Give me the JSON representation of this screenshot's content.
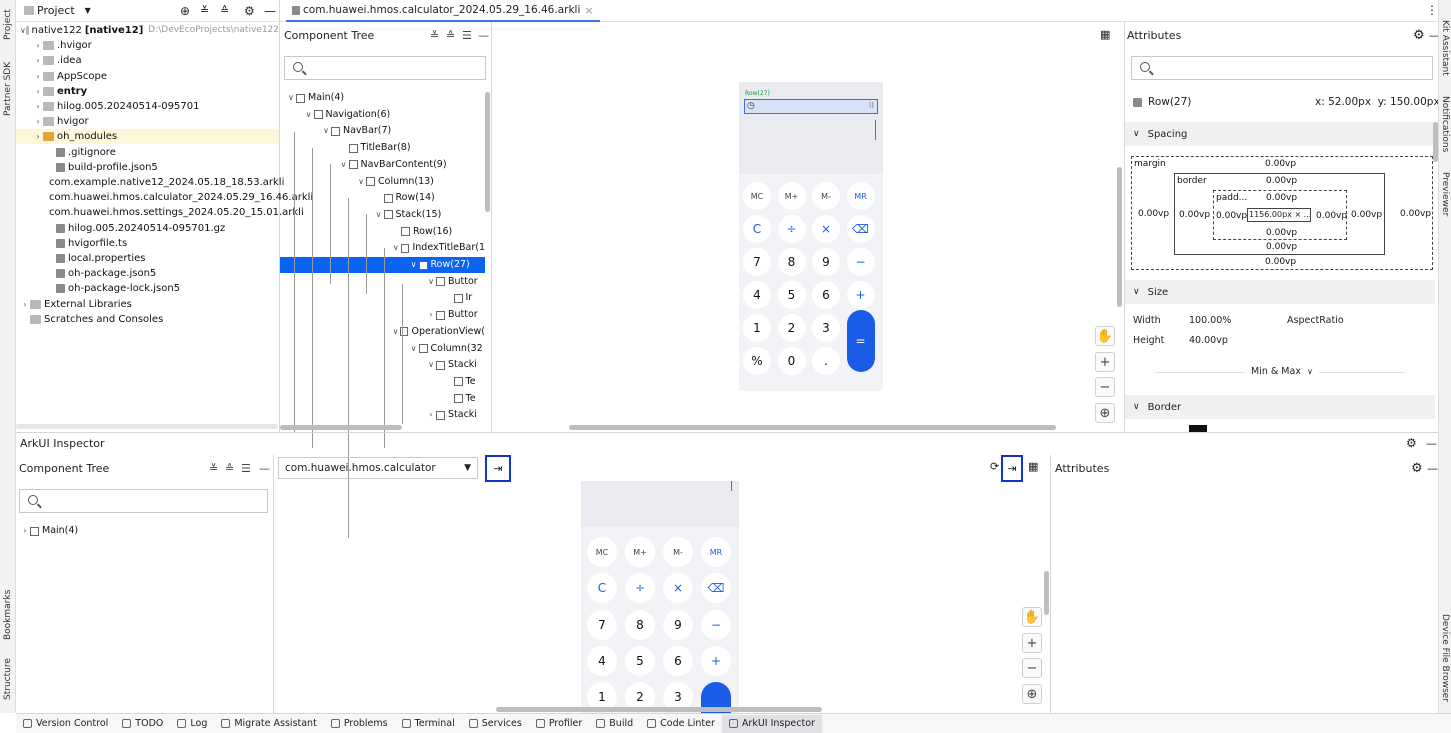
{
  "left_strip": {
    "items": [
      "Project",
      "Partner SDK",
      "Bookmarks",
      "Structure"
    ]
  },
  "right_strip": {
    "items": [
      "Kit Assistant",
      "Notifications",
      "Previewer",
      "Device File Browser"
    ]
  },
  "project_panel": {
    "title": "Project",
    "tree": [
      {
        "label": "native122",
        "bold_label": "[native12]",
        "path": "D:\\DevEcoProjects\\native122",
        "depth": 0,
        "chevron": "v",
        "kind": "folder"
      },
      {
        "label": ".hvigor",
        "depth": 1,
        "chevron": ">",
        "kind": "folder"
      },
      {
        "label": ".idea",
        "depth": 1,
        "chevron": ">",
        "kind": "folder"
      },
      {
        "label": "AppScope",
        "depth": 1,
        "chevron": ">",
        "kind": "folder"
      },
      {
        "label": "entry",
        "depth": 1,
        "chevron": ">",
        "kind": "folder",
        "bold": true
      },
      {
        "label": "hilog.005.20240514-095701",
        "depth": 1,
        "chevron": ">",
        "kind": "folder"
      },
      {
        "label": "hvigor",
        "depth": 1,
        "chevron": ">",
        "kind": "folder"
      },
      {
        "label": "oh_modules",
        "depth": 1,
        "chevron": ">",
        "kind": "folder",
        "highlight": true
      },
      {
        "label": ".gitignore",
        "depth": 2,
        "kind": "file"
      },
      {
        "label": "build-profile.json5",
        "depth": 2,
        "kind": "file"
      },
      {
        "label": "com.example.native12_2024.05.18_18.53.arkli",
        "depth": 2,
        "kind": "file"
      },
      {
        "label": "com.huawei.hmos.calculator_2024.05.29_16.46.arkli",
        "depth": 2,
        "kind": "file"
      },
      {
        "label": "com.huawei.hmos.settings_2024.05.20_15.01.arkli",
        "depth": 2,
        "kind": "file"
      },
      {
        "label": "hilog.005.20240514-095701.gz",
        "depth": 2,
        "kind": "file"
      },
      {
        "label": "hvigorfile.ts",
        "depth": 2,
        "kind": "file"
      },
      {
        "label": "local.properties",
        "depth": 2,
        "kind": "file"
      },
      {
        "label": "oh-package.json5",
        "depth": 2,
        "kind": "file"
      },
      {
        "label": "oh-package-lock.json5",
        "depth": 2,
        "kind": "file"
      },
      {
        "label": "External Libraries",
        "depth": 0,
        "chevron": ">",
        "kind": "lib"
      },
      {
        "label": "Scratches and Consoles",
        "depth": 0,
        "kind": "scratch"
      }
    ]
  },
  "editor_tab": {
    "label": "com.huawei.hmos.calculator_2024.05.29_16.46.arkli",
    "close": "×"
  },
  "top_component_tree": {
    "title": "Component Tree",
    "rows": [
      {
        "label": "Main(4)",
        "depth": 0,
        "chevron": "v"
      },
      {
        "label": "Navigation(6)",
        "depth": 1,
        "chevron": "v"
      },
      {
        "label": "NavBar(7)",
        "depth": 2,
        "chevron": "v"
      },
      {
        "label": "TitleBar(8)",
        "depth": 3
      },
      {
        "label": "NavBarContent(9)",
        "depth": 3,
        "chevron": "v"
      },
      {
        "label": "Column(13)",
        "depth": 4,
        "chevron": "v"
      },
      {
        "label": "Row(14)",
        "depth": 5
      },
      {
        "label": "Stack(15)",
        "depth": 5,
        "chevron": "v"
      },
      {
        "label": "Row(16)",
        "depth": 6
      },
      {
        "label": "IndexTitleBar(1",
        "depth": 6,
        "chevron": "v"
      },
      {
        "label": "Row(27)",
        "depth": 7,
        "chevron": "v",
        "selected": true
      },
      {
        "label": "Buttor",
        "depth": 8,
        "chevron": "v"
      },
      {
        "label": "Ir",
        "depth": 9
      },
      {
        "label": "Buttor",
        "depth": 8,
        "chevron": ">"
      },
      {
        "label": "OperationView(",
        "depth": 6,
        "chevron": "v"
      },
      {
        "label": "Column(32",
        "depth": 7,
        "chevron": "v"
      },
      {
        "label": "Stacki",
        "depth": 8,
        "chevron": "v"
      },
      {
        "label": "Te",
        "depth": 9
      },
      {
        "label": "Te",
        "depth": 9
      },
      {
        "label": "Stacki",
        "depth": 8,
        "chevron": ">"
      }
    ]
  },
  "preview": {
    "row_label": "Row(27)",
    "keys": [
      [
        "MC",
        "M+",
        "M-",
        "MR"
      ],
      [
        "C",
        "÷",
        "×",
        "⌫"
      ],
      [
        "7",
        "8",
        "9",
        "−"
      ],
      [
        "4",
        "5",
        "6",
        "+"
      ],
      [
        "1",
        "2",
        "3",
        "="
      ],
      [
        "%",
        "0",
        ".",
        ""
      ]
    ],
    "accent": "#1a5ce6"
  },
  "attributes": {
    "title": "Attributes",
    "element": "Row(27)",
    "x_label": "x: 52.00px",
    "y_label": "y: 150.00px",
    "spacing": {
      "title": "Spacing",
      "margin_label": "margin",
      "border_label": "border",
      "padding_label": "padd...",
      "margin_top": "0.00vp",
      "margin_left": "0.00vp",
      "margin_right": "0.00vp",
      "margin_bottom": "0.00vp",
      "border_top": "0.00vp",
      "border_left": "0.00vp",
      "border_right": "0.00vp",
      "border_bottom": "0.00vp",
      "padding_top": "0.00vp",
      "padding_left": "0.00vp",
      "padding_right": "0.00vp",
      "padding_bottom": "0.00vp",
      "content": "1156.00px × ..."
    },
    "size": {
      "title": "Size",
      "width_label": "Width",
      "width_value": "100.00%",
      "aspect_label": "AspectRatio",
      "height_label": "Height",
      "height_value": "40.00vp",
      "minmax": "Min & Max"
    },
    "border": {
      "title": "Border"
    }
  },
  "inspector": {
    "title": "ArkUI Inspector",
    "component_tree_title": "Component Tree",
    "tree_root": "Main(4)",
    "app_select": "com.huawei.hmos.calculator",
    "attributes_title": "Attributes",
    "keys": [
      [
        "MC",
        "M+",
        "M-",
        "MR"
      ],
      [
        "C",
        "÷",
        "×",
        "⌫"
      ],
      [
        "7",
        "8",
        "9",
        "−"
      ],
      [
        "4",
        "5",
        "6",
        "+"
      ],
      [
        "1",
        "2",
        "3",
        ""
      ]
    ]
  },
  "bottom_bar": {
    "tabs": [
      "Version Control",
      "TODO",
      "Log",
      "Migrate Assistant",
      "Problems",
      "Terminal",
      "Services",
      "Profiler",
      "Build",
      "Code Linter",
      "ArkUI Inspector"
    ],
    "active": "ArkUI Inspector"
  },
  "colors": {
    "selection": "#0a64f0",
    "highlight_blue_box": "#1133cc",
    "yellow_row": "#fdf6d8"
  }
}
